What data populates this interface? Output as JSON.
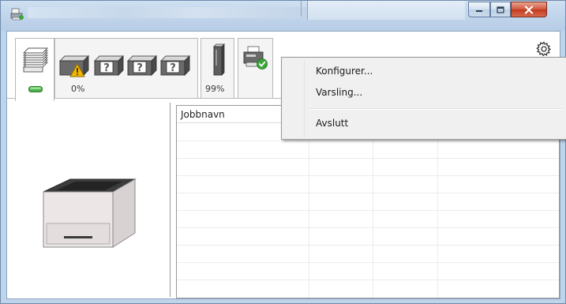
{
  "window": {
    "controls": {
      "minimize_icon": "minimize-icon",
      "maximize_icon": "maximize-icon",
      "close_icon": "close-icon"
    }
  },
  "toolbar": {
    "tabs": [
      {
        "icon": "pages-icon",
        "status": "ok"
      },
      {
        "icon": "toner-icon",
        "status": "warning"
      },
      {
        "icon": "waste-toner-icon"
      },
      {
        "icon": "device-status-icon",
        "status": "ok"
      }
    ],
    "toner_percent": "0%",
    "waste_percent": "99%",
    "settings_icon": "gear-icon"
  },
  "job_list": {
    "columns": [
      {
        "label": "Jobbnavn"
      },
      {
        "label": ""
      },
      {
        "label": ""
      },
      {
        "label": ""
      }
    ]
  },
  "context_menu": {
    "items": [
      {
        "label": "Konfigurer..."
      },
      {
        "label": "Varsling..."
      },
      {
        "label": "Avslutt"
      }
    ]
  },
  "colors": {
    "titlebar": "#c2d6ec",
    "close_button": "#c23a1e",
    "warning": "#f2b600",
    "status_ok": "#3aa53a"
  }
}
